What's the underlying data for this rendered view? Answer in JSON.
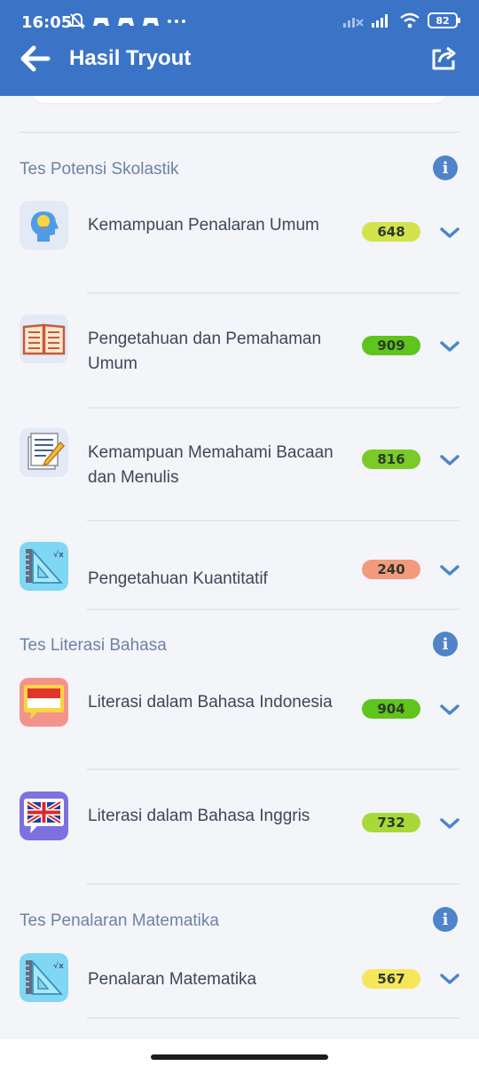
{
  "status": {
    "time": "16:05",
    "battery": "82"
  },
  "header": {
    "title": "Hasil Tryout"
  },
  "sections": [
    {
      "title": "Tes Potensi Skolastik",
      "items": [
        {
          "label": "Kemampuan Penalaran Umum",
          "score": "648",
          "score_color": "#d4e24e",
          "icon": "head-bulb-icon"
        },
        {
          "label": "Pengetahuan dan Pemahaman Umum",
          "score": "909",
          "score_color": "#5fc41c",
          "icon": "open-book-icon"
        },
        {
          "label": "Kemampuan Memahami Bacaan dan Menulis",
          "score": "816",
          "score_color": "#7acb28",
          "icon": "writing-paper-icon"
        },
        {
          "label": "Pengetahuan Kuantitatif",
          "score": "240",
          "score_color": "#f39a7d",
          "icon": "ruler-triangle-icon"
        }
      ]
    },
    {
      "title": "Tes Literasi Bahasa",
      "items": [
        {
          "label": "Literasi dalam Bahasa Indonesia",
          "score": "904",
          "score_color": "#5fc41c",
          "icon": "indonesia-flag-icon"
        },
        {
          "label": "Literasi dalam Bahasa Inggris",
          "score": "732",
          "score_color": "#a8d93b",
          "icon": "uk-flag-icon"
        }
      ]
    },
    {
      "title": "Tes Penalaran Matematika",
      "items": [
        {
          "label": "Penalaran Matematika",
          "score": "567",
          "score_color": "#f6e65a",
          "icon": "ruler-triangle-icon"
        }
      ]
    }
  ]
}
